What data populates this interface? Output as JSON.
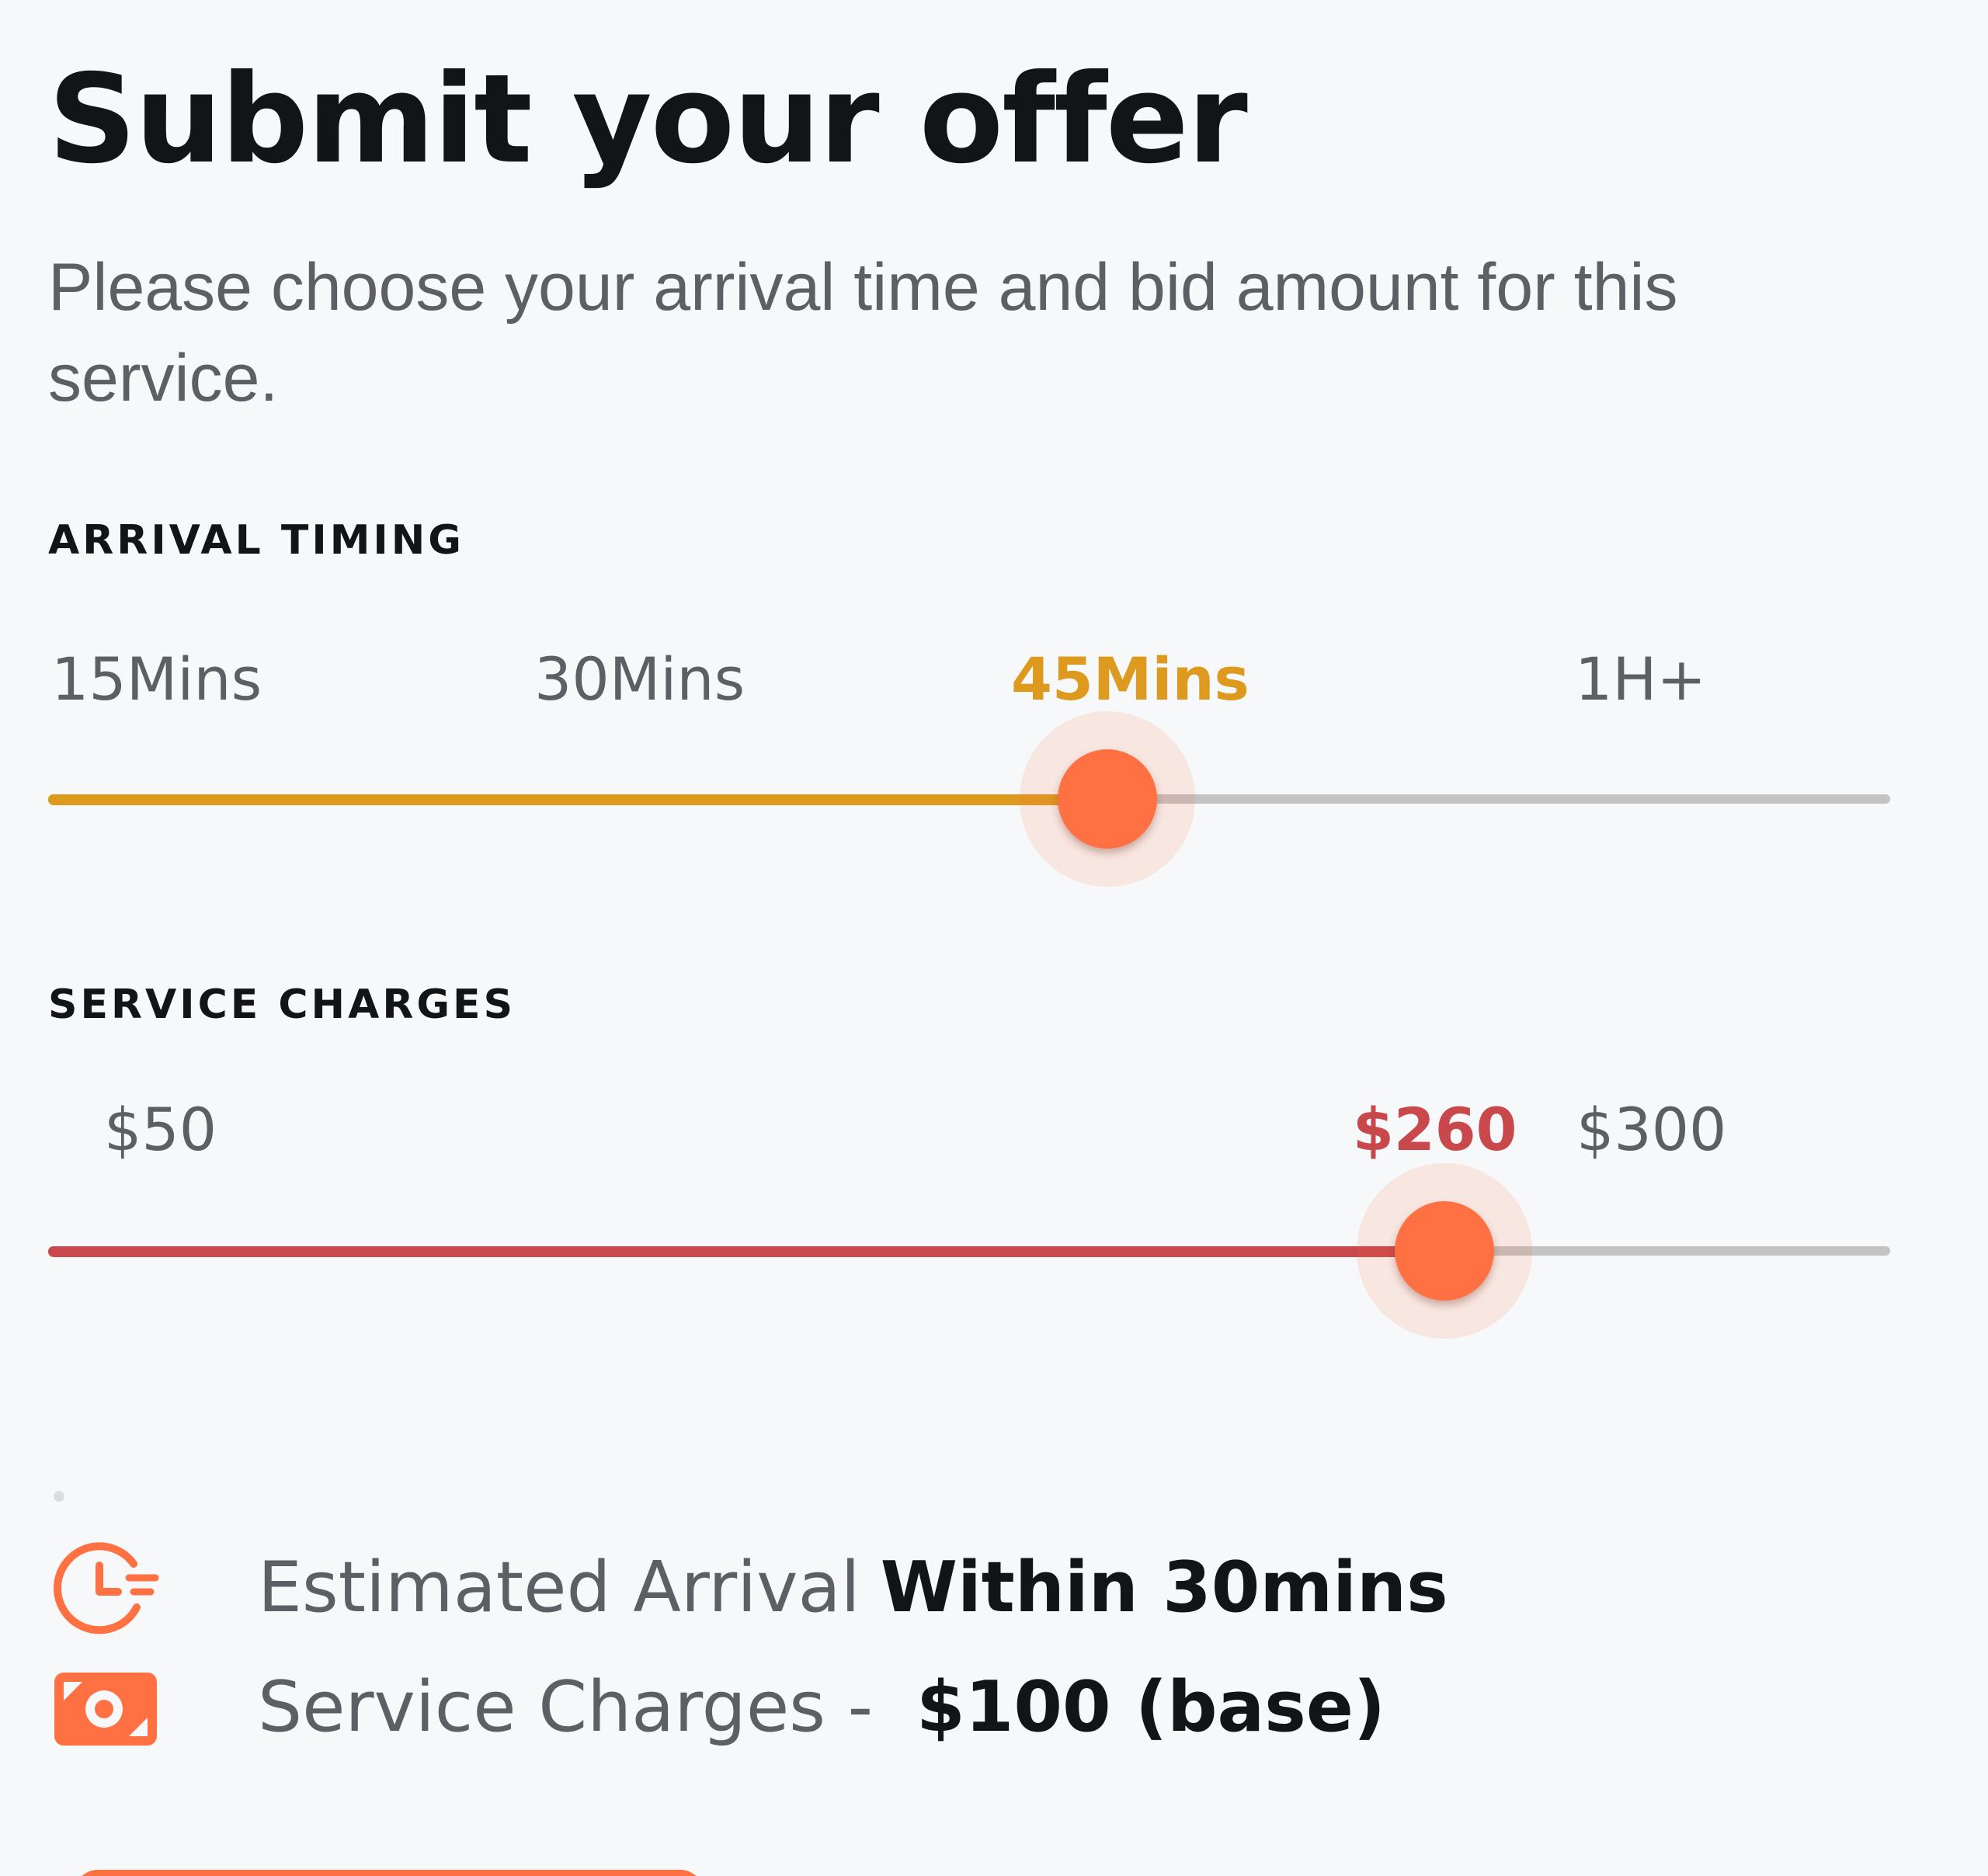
{
  "header": {
    "title": "Submit your offer",
    "subtitle": "Please choose your arrival time and bid amount for this service."
  },
  "arrival": {
    "label": "ARRIVAL TIMING",
    "ticks": [
      "15Mins",
      "30Mins",
      "45Mins",
      "1H+"
    ],
    "selected": "45Mins",
    "fill_fraction": 0.575,
    "accent": "#dd9a1e"
  },
  "charges": {
    "label": "SERVICE CHARGES",
    "ticks": [
      "$50",
      "$260",
      "$300"
    ],
    "selected": "$260",
    "min": 50,
    "value": 260,
    "fill_fraction": 0.758,
    "accent": "#c8484c"
  },
  "summary": {
    "arrival_label": "Estimated Arrival",
    "arrival_value": "Within 30mins",
    "arrival_icon": "clock-icon",
    "charges_label": "Service Charges -",
    "charges_value": "$100 (base)",
    "charges_icon": "cash-icon"
  },
  "colors": {
    "thumb": "#ff7043",
    "track": "#c3c3c3",
    "background": "#f7f8fa"
  }
}
